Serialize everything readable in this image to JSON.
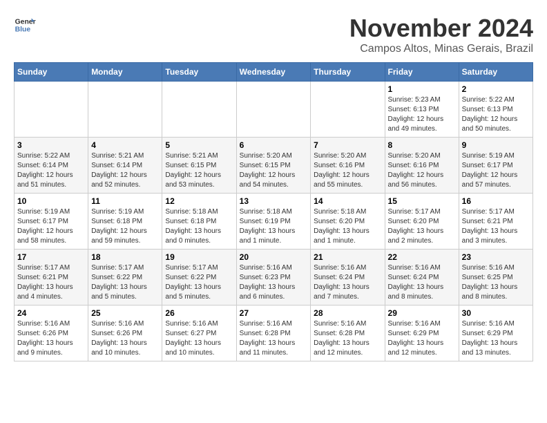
{
  "header": {
    "logo_general": "General",
    "logo_blue": "Blue",
    "month_year": "November 2024",
    "location": "Campos Altos, Minas Gerais, Brazil"
  },
  "days_of_week": [
    "Sunday",
    "Monday",
    "Tuesday",
    "Wednesday",
    "Thursday",
    "Friday",
    "Saturday"
  ],
  "weeks": [
    {
      "days": [
        {
          "num": "",
          "info": ""
        },
        {
          "num": "",
          "info": ""
        },
        {
          "num": "",
          "info": ""
        },
        {
          "num": "",
          "info": ""
        },
        {
          "num": "",
          "info": ""
        },
        {
          "num": "1",
          "info": "Sunrise: 5:23 AM\nSunset: 6:13 PM\nDaylight: 12 hours and 49 minutes."
        },
        {
          "num": "2",
          "info": "Sunrise: 5:22 AM\nSunset: 6:13 PM\nDaylight: 12 hours and 50 minutes."
        }
      ]
    },
    {
      "days": [
        {
          "num": "3",
          "info": "Sunrise: 5:22 AM\nSunset: 6:14 PM\nDaylight: 12 hours and 51 minutes."
        },
        {
          "num": "4",
          "info": "Sunrise: 5:21 AM\nSunset: 6:14 PM\nDaylight: 12 hours and 52 minutes."
        },
        {
          "num": "5",
          "info": "Sunrise: 5:21 AM\nSunset: 6:15 PM\nDaylight: 12 hours and 53 minutes."
        },
        {
          "num": "6",
          "info": "Sunrise: 5:20 AM\nSunset: 6:15 PM\nDaylight: 12 hours and 54 minutes."
        },
        {
          "num": "7",
          "info": "Sunrise: 5:20 AM\nSunset: 6:16 PM\nDaylight: 12 hours and 55 minutes."
        },
        {
          "num": "8",
          "info": "Sunrise: 5:20 AM\nSunset: 6:16 PM\nDaylight: 12 hours and 56 minutes."
        },
        {
          "num": "9",
          "info": "Sunrise: 5:19 AM\nSunset: 6:17 PM\nDaylight: 12 hours and 57 minutes."
        }
      ]
    },
    {
      "days": [
        {
          "num": "10",
          "info": "Sunrise: 5:19 AM\nSunset: 6:17 PM\nDaylight: 12 hours and 58 minutes."
        },
        {
          "num": "11",
          "info": "Sunrise: 5:19 AM\nSunset: 6:18 PM\nDaylight: 12 hours and 59 minutes."
        },
        {
          "num": "12",
          "info": "Sunrise: 5:18 AM\nSunset: 6:18 PM\nDaylight: 13 hours and 0 minutes."
        },
        {
          "num": "13",
          "info": "Sunrise: 5:18 AM\nSunset: 6:19 PM\nDaylight: 13 hours and 1 minute."
        },
        {
          "num": "14",
          "info": "Sunrise: 5:18 AM\nSunset: 6:20 PM\nDaylight: 13 hours and 1 minute."
        },
        {
          "num": "15",
          "info": "Sunrise: 5:17 AM\nSunset: 6:20 PM\nDaylight: 13 hours and 2 minutes."
        },
        {
          "num": "16",
          "info": "Sunrise: 5:17 AM\nSunset: 6:21 PM\nDaylight: 13 hours and 3 minutes."
        }
      ]
    },
    {
      "days": [
        {
          "num": "17",
          "info": "Sunrise: 5:17 AM\nSunset: 6:21 PM\nDaylight: 13 hours and 4 minutes."
        },
        {
          "num": "18",
          "info": "Sunrise: 5:17 AM\nSunset: 6:22 PM\nDaylight: 13 hours and 5 minutes."
        },
        {
          "num": "19",
          "info": "Sunrise: 5:17 AM\nSunset: 6:22 PM\nDaylight: 13 hours and 5 minutes."
        },
        {
          "num": "20",
          "info": "Sunrise: 5:16 AM\nSunset: 6:23 PM\nDaylight: 13 hours and 6 minutes."
        },
        {
          "num": "21",
          "info": "Sunrise: 5:16 AM\nSunset: 6:24 PM\nDaylight: 13 hours and 7 minutes."
        },
        {
          "num": "22",
          "info": "Sunrise: 5:16 AM\nSunset: 6:24 PM\nDaylight: 13 hours and 8 minutes."
        },
        {
          "num": "23",
          "info": "Sunrise: 5:16 AM\nSunset: 6:25 PM\nDaylight: 13 hours and 8 minutes."
        }
      ]
    },
    {
      "days": [
        {
          "num": "24",
          "info": "Sunrise: 5:16 AM\nSunset: 6:26 PM\nDaylight: 13 hours and 9 minutes."
        },
        {
          "num": "25",
          "info": "Sunrise: 5:16 AM\nSunset: 6:26 PM\nDaylight: 13 hours and 10 minutes."
        },
        {
          "num": "26",
          "info": "Sunrise: 5:16 AM\nSunset: 6:27 PM\nDaylight: 13 hours and 10 minutes."
        },
        {
          "num": "27",
          "info": "Sunrise: 5:16 AM\nSunset: 6:28 PM\nDaylight: 13 hours and 11 minutes."
        },
        {
          "num": "28",
          "info": "Sunrise: 5:16 AM\nSunset: 6:28 PM\nDaylight: 13 hours and 12 minutes."
        },
        {
          "num": "29",
          "info": "Sunrise: 5:16 AM\nSunset: 6:29 PM\nDaylight: 13 hours and 12 minutes."
        },
        {
          "num": "30",
          "info": "Sunrise: 5:16 AM\nSunset: 6:29 PM\nDaylight: 13 hours and 13 minutes."
        }
      ]
    }
  ]
}
